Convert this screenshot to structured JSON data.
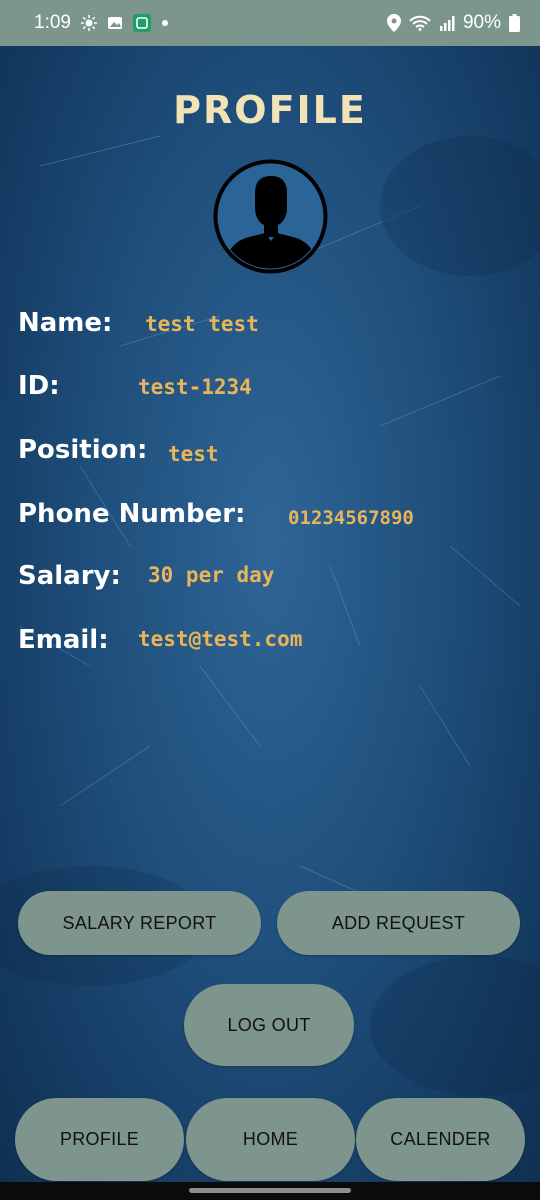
{
  "status_bar": {
    "time": "1:09",
    "battery": "90%",
    "icons": [
      "brightness-icon",
      "image-icon",
      "app-notification-icon",
      "dot-icon",
      "location-icon",
      "wifi-icon",
      "signal-icon",
      "battery-icon"
    ]
  },
  "profile": {
    "title": "PROFILE",
    "fields": [
      {
        "label": "Name:",
        "value": "test test"
      },
      {
        "label": "ID:",
        "value": "test-1234"
      },
      {
        "label": "Position:",
        "value": "test"
      },
      {
        "label": "Phone Number:",
        "value": "01234567890"
      },
      {
        "label": "Salary:",
        "value": "30 per day"
      },
      {
        "label": "Email:",
        "value": "test@test.com"
      }
    ]
  },
  "actions": {
    "salary_report": "SALARY REPORT",
    "add_request": "ADD REQUEST",
    "log_out": "LOG OUT"
  },
  "bottom_nav": {
    "profile": "PROFILE",
    "home": "HOME",
    "calender": "CALENDER"
  },
  "colors": {
    "background": "#1f4f7c",
    "title": "#f2e3b7",
    "value": "#e9b55a",
    "button": "#7d958c",
    "status_bar": "#7c968d"
  }
}
